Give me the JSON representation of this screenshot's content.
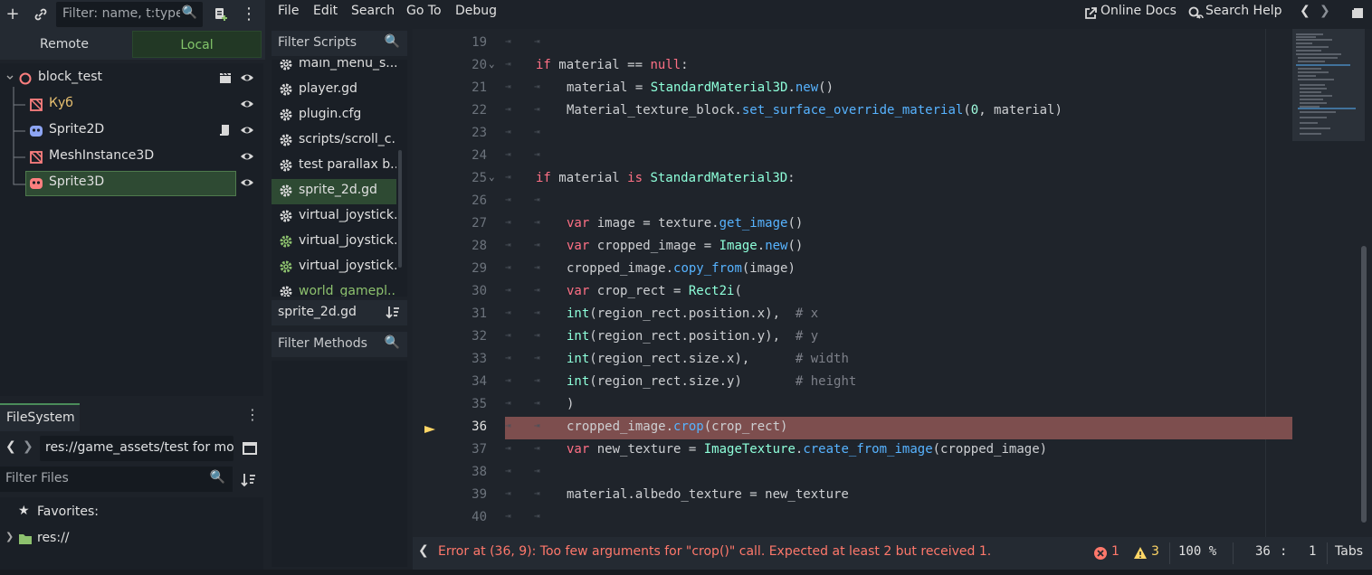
{
  "scene_dock": {
    "filter_placeholder": "Filter: name, t:type,",
    "tab_remote": "Remote",
    "tab_local": "Local",
    "nodes": [
      {
        "label": "block_test",
        "color": "#e0e0e0"
      },
      {
        "label": "Куб",
        "color": "#e8c070"
      },
      {
        "label": "Sprite2D",
        "color": "#e0e0e0"
      },
      {
        "label": "MeshInstance3D",
        "color": "#e0e0e0"
      },
      {
        "label": "Sprite3D",
        "color": "#e0e0e0"
      }
    ]
  },
  "filesystem": {
    "tab": "FileSystem",
    "path": "res://game_assets/test for mo",
    "filter_placeholder": "Filter Files",
    "items": [
      {
        "label": "Favorites:"
      },
      {
        "label": "res://"
      }
    ]
  },
  "scripts": {
    "filter_placeholder": "Filter Scripts",
    "items": [
      {
        "label": "main_menu_s..."
      },
      {
        "label": "player.gd"
      },
      {
        "label": "plugin.cfg"
      },
      {
        "label": "scripts/scroll_c..."
      },
      {
        "label": "test parallax b..."
      },
      {
        "label": "sprite_2d.gd"
      },
      {
        "label": "virtual_joystick..."
      },
      {
        "label": "virtual_joystick..."
      },
      {
        "label": "virtual_joystick..."
      },
      {
        "label": "world_gamepl..."
      }
    ],
    "current": "sprite_2d.gd",
    "filter_methods_placeholder": "Filter Methods"
  },
  "menubar": {
    "file": "File",
    "edit": "Edit",
    "search": "Search",
    "goto": "Go To",
    "debug": "Debug",
    "online_docs": "Online Docs",
    "search_help": "Search Help"
  },
  "code_lines": [
    {
      "n": "19",
      "fold": false,
      "tabs": "",
      "html": ""
    },
    {
      "n": "20",
      "fold": true,
      "tabs": "",
      "html": "<span class='kw'>if</span> material == <span class='kw'>null</span>:"
    },
    {
      "n": "21",
      "fold": false,
      "tabs": "t",
      "html": "material = <span class='ty'>StandardMaterial3D</span>.<span class='fn'>new</span>()"
    },
    {
      "n": "22",
      "fold": false,
      "tabs": "t",
      "html": "Material_texture_block.<span class='fn'>set_surface_override_material</span>(<span class='num'>0</span>, material)"
    },
    {
      "n": "23",
      "fold": false,
      "tabs": "",
      "html": ""
    },
    {
      "n": "24",
      "fold": false,
      "tabs": "",
      "html": ""
    },
    {
      "n": "25",
      "fold": true,
      "tabs": "",
      "html": "<span class='kw'>if</span> material <span class='kw'>is</span> <span class='ty'>StandardMaterial3D</span>:"
    },
    {
      "n": "26",
      "fold": false,
      "tabs": "",
      "html": ""
    },
    {
      "n": "27",
      "fold": false,
      "tabs": "t",
      "html": "<span class='kw'>var</span> image = texture.<span class='fn'>get_image</span>()"
    },
    {
      "n": "28",
      "fold": false,
      "tabs": "t",
      "html": "<span class='kw'>var</span> cropped_image = <span class='ty'>Image</span>.<span class='fn'>new</span>()"
    },
    {
      "n": "29",
      "fold": false,
      "tabs": "t",
      "html": "cropped_image.<span class='fn'>copy_from</span>(image)"
    },
    {
      "n": "30",
      "fold": false,
      "tabs": "t",
      "html": "<span class='kw'>var</span> crop_rect = <span class='ty'>Rect2i</span>("
    },
    {
      "n": "31",
      "fold": false,
      "tabs": "t",
      "html": "<span class='ty'>int</span>(region_rect.position.x),  <span class='cm'># x</span>"
    },
    {
      "n": "32",
      "fold": false,
      "tabs": "t",
      "html": "<span class='ty'>int</span>(region_rect.position.y),  <span class='cm'># y</span>"
    },
    {
      "n": "33",
      "fold": false,
      "tabs": "t",
      "html": "<span class='ty'>int</span>(region_rect.size.x),      <span class='cm'># width</span>"
    },
    {
      "n": "34",
      "fold": false,
      "tabs": "t",
      "html": "<span class='ty'>int</span>(region_rect.size.y)       <span class='cm'># height</span>"
    },
    {
      "n": "35",
      "fold": false,
      "tabs": "t",
      "html": ")"
    },
    {
      "n": "36",
      "fold": false,
      "tabs": "t",
      "html": "cropped_image.<span class='fn'>crop</span>(crop_rect)",
      "error": true
    },
    {
      "n": "37",
      "fold": false,
      "tabs": "t",
      "html": "<span class='kw'>var</span> new_texture = <span class='ty'>ImageTexture</span>.<span class='fn'>create_from_image</span>(cropped_image)"
    },
    {
      "n": "38",
      "fold": false,
      "tabs": "",
      "html": ""
    },
    {
      "n": "39",
      "fold": false,
      "tabs": "t",
      "html": "material.albedo_texture = new_texture"
    },
    {
      "n": "40",
      "fold": false,
      "tabs": "",
      "html": ""
    }
  ],
  "status": {
    "message": "Error at (36, 9): Too few arguments for \"crop()\" call. Expected at least 2 but received 1.",
    "errors": "1",
    "warnings": "3",
    "zoom": "100 %",
    "line": "36",
    "sep": ":",
    "col": "1",
    "indent": "Tabs"
  },
  "colors": {
    "accent_green": "#83c56a",
    "error_line": "#7d4e4e",
    "error_text": "#ff786b",
    "warning": "#ffd666"
  }
}
